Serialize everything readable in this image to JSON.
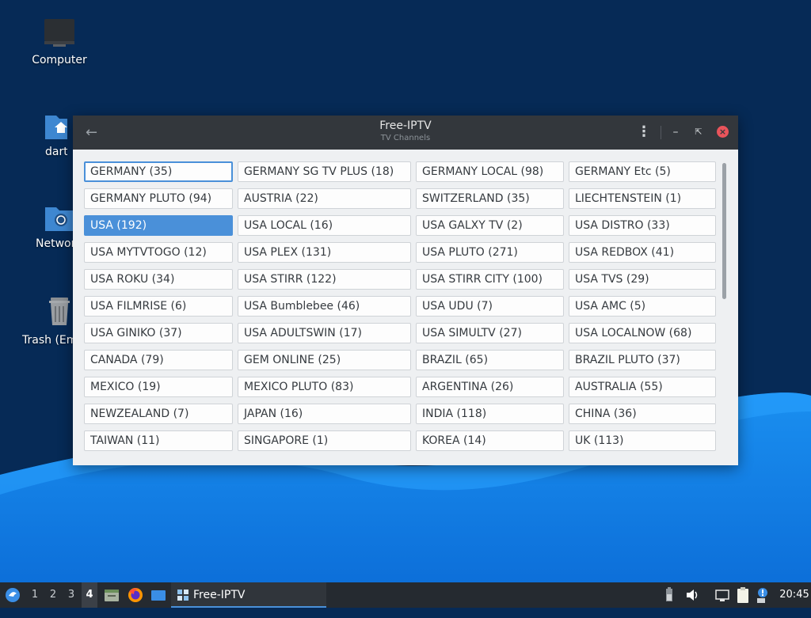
{
  "desktop": {
    "icons": [
      {
        "label": "Computer"
      },
      {
        "label": "dartz"
      },
      {
        "label": "Network"
      },
      {
        "label": "Trash (Empty)"
      }
    ]
  },
  "window": {
    "title": "Free-IPTV",
    "subtitle": "TV Channels",
    "icons": {
      "back": "back-arrow-icon",
      "menu": "kebab-menu-icon",
      "minimize": "minimize-icon",
      "restore": "restore-icon",
      "close": "close-icon"
    },
    "selected_channel": "USA (192)",
    "focused_channel": "GERMANY (35)",
    "channels": [
      "GERMANY (35)",
      "GERMANY SG TV PLUS (18)",
      "GERMANY LOCAL (98)",
      "GERMANY Etc (5)",
      "GERMANY PLUTO (94)",
      "AUSTRIA (22)",
      "SWITZERLAND (35)",
      "LIECHTENSTEIN (1)",
      "USA (192)",
      "USA LOCAL (16)",
      "USA GALXY TV (2)",
      "USA DISTRO (33)",
      "USA MYTVTOGO (12)",
      "USA PLEX (131)",
      "USA PLUTO (271)",
      "USA REDBOX (41)",
      "USA ROKU (34)",
      "USA STIRR (122)",
      "USA STIRR CITY (100)",
      "USA TVS (29)",
      "USA FILMRISE (6)",
      "USA Bumblebee (46)",
      "USA UDU (7)",
      "USA AMC (5)",
      "USA GINIKO (37)",
      "USA ADULTSWIN (17)",
      "USA SIMULTV (27)",
      "USA LOCALNOW (68)",
      "CANADA (79)",
      "GEM ONLINE (25)",
      "BRAZIL (65)",
      "BRAZIL PLUTO (37)",
      "MEXICO (19)",
      "MEXICO PLUTO (83)",
      "ARGENTINA (26)",
      "AUSTRALIA (55)",
      "NEWZEALAND (7)",
      "JAPAN (16)",
      "INDIA (118)",
      "CHINA (36)",
      "TAIWAN (11)",
      "SINGAPORE (1)",
      "KOREA (14)",
      "UK (113)"
    ]
  },
  "taskbar": {
    "workspaces": [
      "1",
      "2",
      "3",
      "4"
    ],
    "active_workspace": "4",
    "task_label": "Free-IPTV",
    "clock": "20:45",
    "icons": [
      "start-menu-icon",
      "file-manager-icon",
      "firefox-icon",
      "desktop-icon",
      "app-icon",
      "battery-icon",
      "volume-icon",
      "network-icon",
      "clipboard-icon",
      "notification-icon"
    ]
  },
  "colors": {
    "accent": "#4a90d9",
    "titlebar": "#33373c",
    "close": "#e9545b",
    "desktop": "#062a56",
    "taskbar": "#252a30"
  }
}
